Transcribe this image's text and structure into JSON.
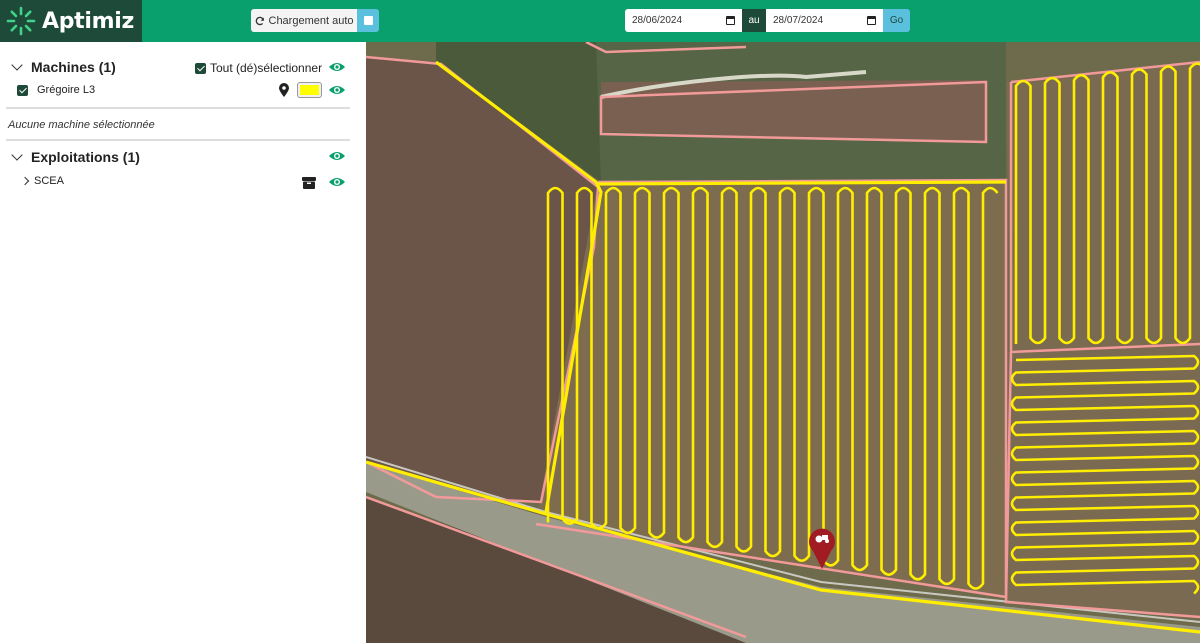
{
  "app": {
    "name": "Aptimiz"
  },
  "toolbar": {
    "auto_load_label": "Chargement auto",
    "date_from": "28/06/2024",
    "date_separator": "au",
    "date_to": "28/07/2024",
    "go_label": "Go"
  },
  "sidebar": {
    "machines": {
      "title": "Machines (1)",
      "select_all_label": "Tout (dé)sélectionner",
      "items": [
        {
          "name": "Grégoire L3",
          "color": "#ffff00"
        }
      ],
      "empty_message": "Aucune machine sélectionnée"
    },
    "farms": {
      "title": "Exploitations (1)",
      "items": [
        {
          "name": "SCEA"
        }
      ]
    }
  },
  "colors": {
    "brand_green": "#0aa06e",
    "dark_green": "#1e4a3a",
    "accent_blue": "#5bc0de",
    "track_yellow": "#ffee00",
    "parcel_pink": "#f29a9a",
    "marker_red": "#a01c22"
  }
}
